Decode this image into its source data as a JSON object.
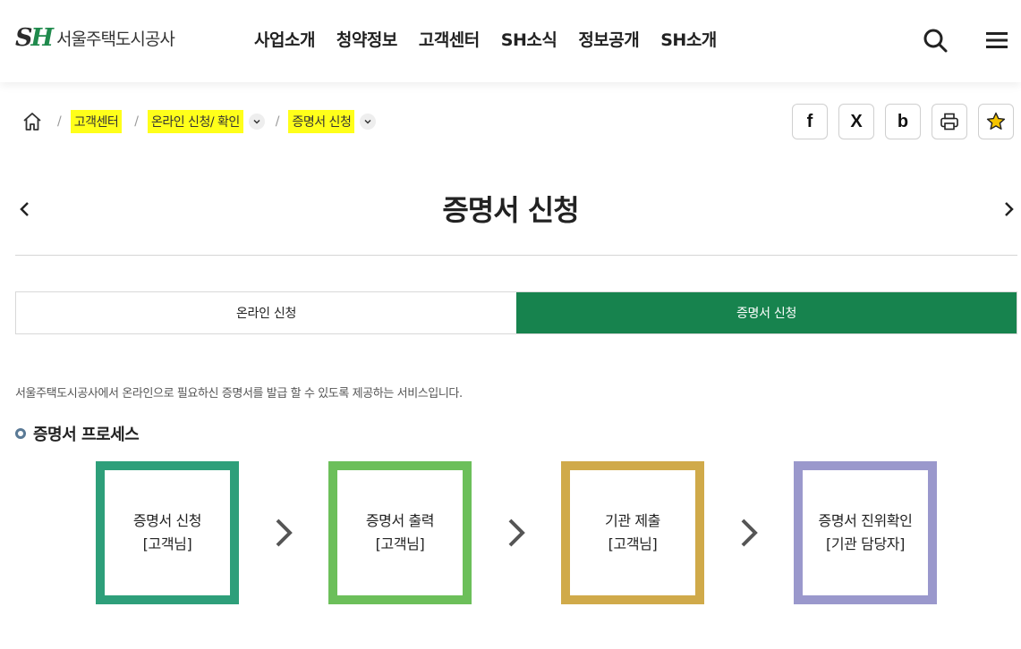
{
  "header": {
    "logo_mark_s": "S",
    "logo_mark_h": "H",
    "logo_text": "서울주택도시공사",
    "nav": [
      "사업소개",
      "청약정보",
      "고객센터",
      "SH소식",
      "정보공개",
      "SH소개"
    ],
    "icons": {
      "search": "search-icon",
      "menu": "hamburger-menu-icon"
    }
  },
  "breadcrumb": {
    "home_icon": "home-icon",
    "items": [
      "고객센터",
      "온라인 신청/ 확인",
      "증명서 신청"
    ],
    "separator": "/"
  },
  "share": {
    "facebook": "f",
    "x": "X",
    "blog": "b",
    "print_icon": "printer-icon",
    "favorite_icon": "star-icon"
  },
  "page": {
    "title": "증명서 신청",
    "description": "서울주택도시공사에서 온라인으로 필요하신 증명서를 발급 할 수 있도록 제공하는 서비스입니다.",
    "section_title": "증명서 프로세스"
  },
  "tabs": [
    {
      "label": "온라인 신청",
      "active": false
    },
    {
      "label": "증명서 신청",
      "active": true
    }
  ],
  "process": [
    {
      "line1": "증명서 신청",
      "line2": "[고객님]",
      "color": "#2e9f7a"
    },
    {
      "line1": "증명서 출력",
      "line2": "[고객님]",
      "color": "#6cbf5a"
    },
    {
      "line1": "기관 제출",
      "line2": "[고객님]",
      "color": "#d0aa4a"
    },
    {
      "line1": "증명서 진위확인",
      "line2": "[기관 담당자]",
      "color": "#9a98cc"
    }
  ],
  "colors": {
    "accent_green": "#17834e",
    "highlight": "#ffff1a"
  }
}
